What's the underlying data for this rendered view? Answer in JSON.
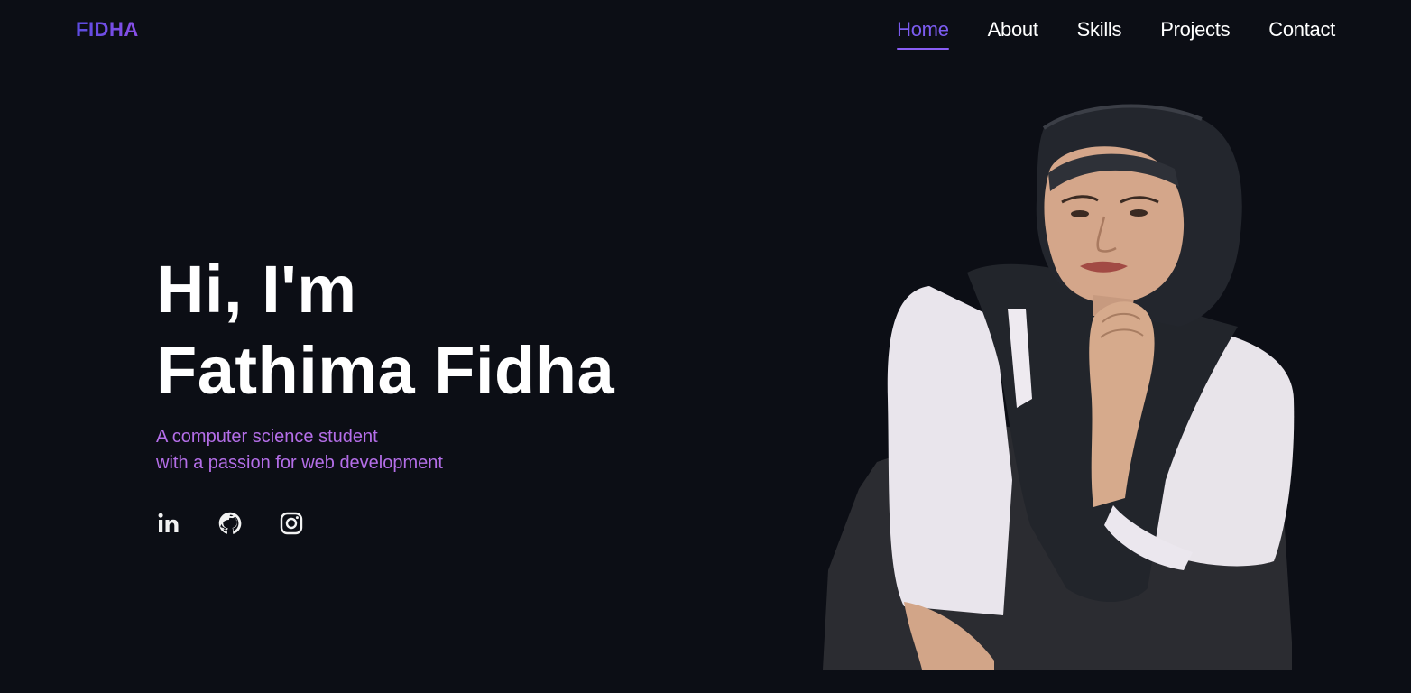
{
  "header": {
    "logo": "FIDHA",
    "nav": [
      {
        "label": "Home",
        "active": true
      },
      {
        "label": "About",
        "active": false
      },
      {
        "label": "Skills",
        "active": false
      },
      {
        "label": "Projects",
        "active": false
      },
      {
        "label": "Contact",
        "active": false
      }
    ]
  },
  "hero": {
    "greeting": "Hi, I'm",
    "name": "Fathima Fidha",
    "tagline_line1": "A computer science student",
    "tagline_line2": "with a passion for web development",
    "socials": [
      {
        "icon": "linkedin-icon"
      },
      {
        "icon": "github-icon"
      },
      {
        "icon": "instagram-icon"
      }
    ]
  },
  "colors": {
    "background": "#0c0e15",
    "accent": "#7c5cf0",
    "tagline": "#b46ee8"
  }
}
